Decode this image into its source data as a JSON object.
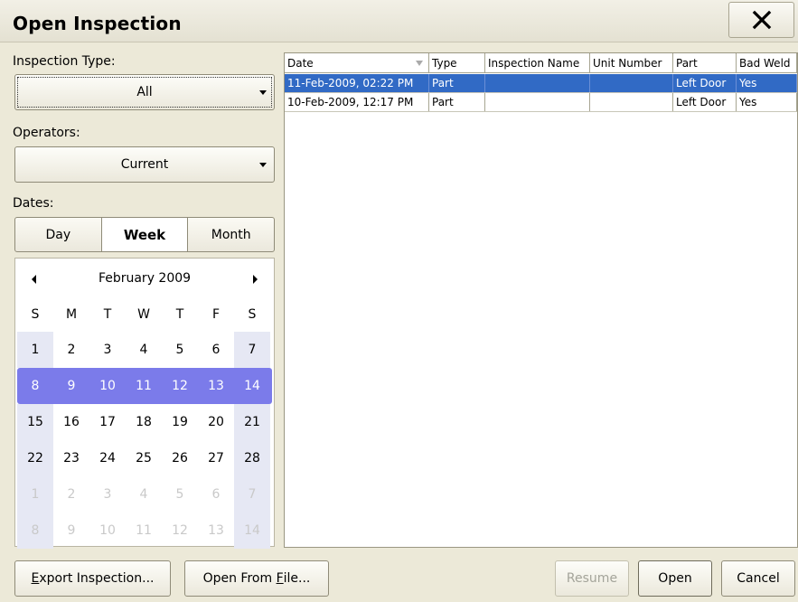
{
  "window": {
    "title": "Open Inspection"
  },
  "inspection_type": {
    "label": "Inspection Type:",
    "value": "All"
  },
  "operators": {
    "label": "Operators:",
    "value": "Current"
  },
  "dates": {
    "label": "Dates:",
    "tabs": [
      "Day",
      "Week",
      "Month"
    ],
    "active_tab": "Week"
  },
  "calendar": {
    "month_label": "February 2009",
    "weekdays": [
      "S",
      "M",
      "T",
      "W",
      "T",
      "F",
      "S"
    ],
    "weeks": [
      [
        "1",
        "2",
        "3",
        "4",
        "5",
        "6",
        "7"
      ],
      [
        "8",
        "9",
        "10",
        "11",
        "12",
        "13",
        "14"
      ],
      [
        "15",
        "16",
        "17",
        "18",
        "19",
        "20",
        "21"
      ],
      [
        "22",
        "23",
        "24",
        "25",
        "26",
        "27",
        "28"
      ],
      [
        "1",
        "2",
        "3",
        "4",
        "5",
        "6",
        "7"
      ],
      [
        "8",
        "9",
        "10",
        "11",
        "12",
        "13",
        "14"
      ]
    ],
    "selected_week_index": 1,
    "muted_week_indices": [
      4,
      5
    ],
    "selection_color": "#7b7bea"
  },
  "table": {
    "columns": [
      "Date",
      "Type",
      "Inspection Name",
      "Unit Number",
      "Part",
      "Bad Weld"
    ],
    "rows": [
      [
        "11-Feb-2009, 02:22 PM",
        "Part",
        "",
        "",
        "Left Door",
        "Yes"
      ],
      [
        "10-Feb-2009, 12:17 PM",
        "Part",
        "",
        "",
        "Left Door",
        "Yes"
      ]
    ],
    "selected_row": 0,
    "selection_color": "#316ac5"
  },
  "buttons": {
    "export_prefix": "E",
    "export_rest": "xport Inspection...",
    "open_file_prefix": "Open From ",
    "open_file_mnemonic": "F",
    "open_file_rest": "ile...",
    "resume": "Resume",
    "open": "Open",
    "cancel": "Cancel"
  }
}
